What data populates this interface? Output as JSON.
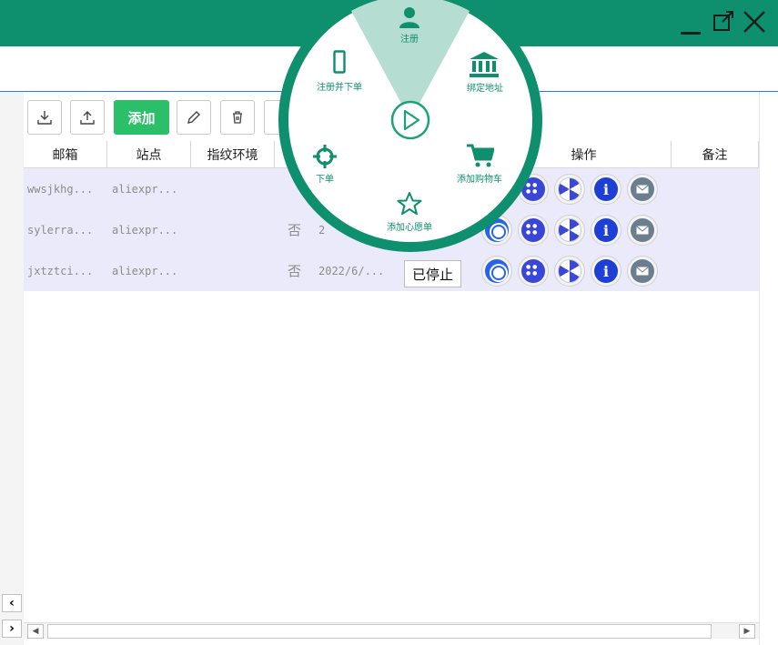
{
  "toolbar": {
    "download_icon": "download-icon",
    "upload_icon": "upload-icon",
    "add_label": "添加",
    "edit_icon": "pencil-icon",
    "delete_icon": "trash-icon"
  },
  "table": {
    "columns": [
      "邮箱",
      "站点",
      "指纹环境",
      "操作",
      "备注"
    ],
    "rows": [
      {
        "email": "wwsjkhg...",
        "site": "aliexpr...",
        "fingerprint": "",
        "flag": "",
        "date": "",
        "status": ""
      },
      {
        "email": "sylerra...",
        "site": "aliexpr...",
        "fingerprint": "",
        "flag": "否",
        "date": "2",
        "status": ""
      },
      {
        "email": "jxtztci...",
        "site": "aliexpr...",
        "fingerprint": "",
        "flag": "否",
        "date": "2022/6/...",
        "status": "已停止"
      }
    ]
  },
  "radial_menu": {
    "center_icon": "play-icon",
    "items": [
      {
        "label": "注册",
        "icon": "user-icon"
      },
      {
        "label": "绑定地址",
        "icon": "bank-icon"
      },
      {
        "label": "添加购物车",
        "icon": "cart-icon"
      },
      {
        "label": "添加心愿单",
        "icon": "star-icon"
      },
      {
        "label": "下单",
        "icon": "crosshair-icon"
      },
      {
        "label": "注册并下单",
        "icon": "phone-icon"
      }
    ]
  },
  "colors": {
    "brand": "#0e8f6e",
    "add_button": "#2bbf6a",
    "row_background": "#eaeafb"
  }
}
